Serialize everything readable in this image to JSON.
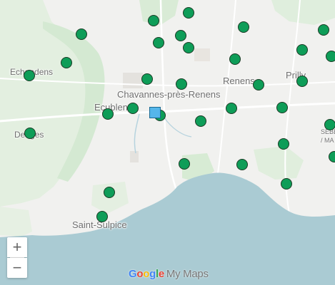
{
  "map": {
    "places": [
      {
        "id": "echandens",
        "label": "Echandens"
      },
      {
        "id": "chavannes",
        "label": "Chavannes-près-Renens"
      },
      {
        "id": "ecublens",
        "label": "Ecublens"
      },
      {
        "id": "renens",
        "label": "Renens"
      },
      {
        "id": "prilly",
        "label": "Prilly"
      },
      {
        "id": "denges",
        "label": "Denges"
      },
      {
        "id": "saint-sulpice",
        "label": "Saint-Sulpice"
      },
      {
        "id": "sebeillon",
        "label": "SÉBE"
      },
      {
        "id": "malley",
        "label": "/ MA"
      }
    ],
    "marker_color": "#0e9d58",
    "highlight_marker_color": "#55b6ea",
    "marker_count": 31,
    "water_color": "#aacbd3",
    "park_color": "#cfe6cf"
  },
  "controls": {
    "zoom_in": "+",
    "zoom_out": "−"
  },
  "branding": {
    "g1": "G",
    "g2": "o",
    "g3": "o",
    "g4": "g",
    "g5": "l",
    "g6": "e",
    "product": "My Maps"
  }
}
